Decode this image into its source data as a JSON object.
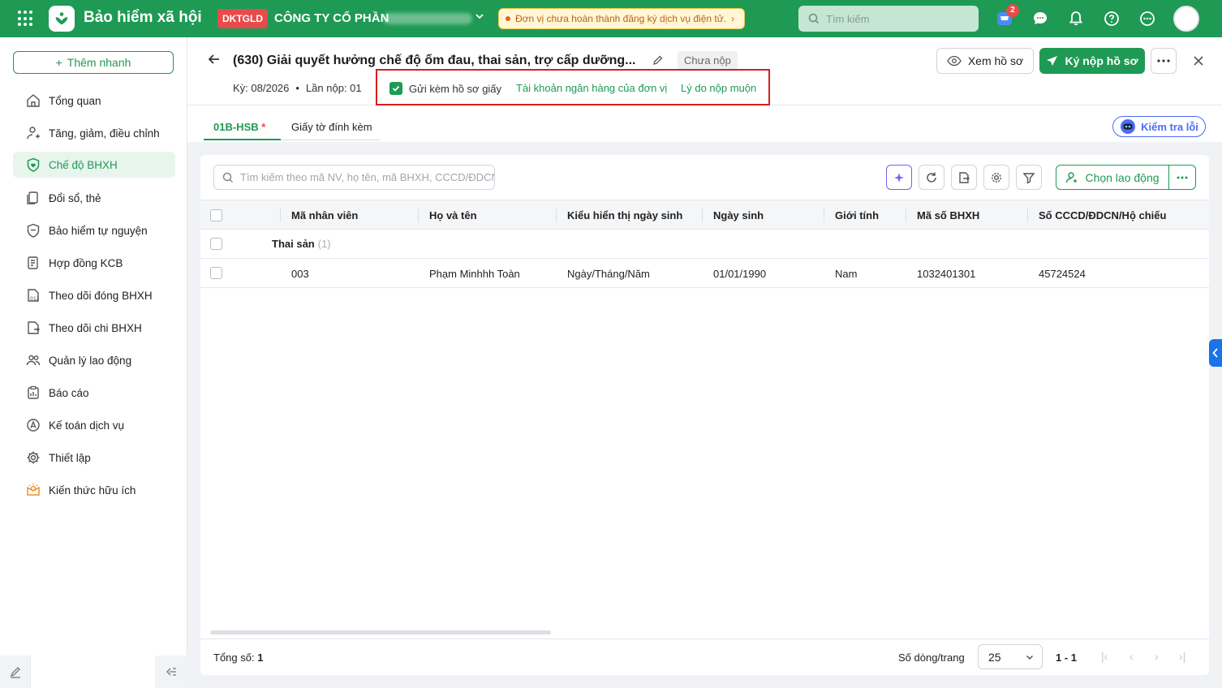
{
  "topbar": {
    "brand": "Bảo hiểm xã hội",
    "badge": "DKTGLD",
    "company": "CÔNG TY CỔ PHẦN",
    "warning": "Đơn vị chưa hoàn thành đăng ký dịch vụ điện tử.",
    "search_placeholder": "Tìm kiếm",
    "cart_count": "2"
  },
  "sidebar": {
    "quick_add": "Thêm nhanh",
    "items": [
      {
        "label": "Tổng quan",
        "icon": "home-icon"
      },
      {
        "label": "Tăng, giảm, điều chỉnh",
        "icon": "user-adjust-icon"
      },
      {
        "label": "Chế độ BHXH",
        "icon": "shield-heart-icon",
        "active": true
      },
      {
        "label": "Đổi sổ, thẻ",
        "icon": "cards-icon"
      },
      {
        "label": "Bảo hiểm tự nguyện",
        "icon": "shield-icon"
      },
      {
        "label": "Hợp đồng KCB",
        "icon": "contract-icon"
      },
      {
        "label": "Theo dõi đóng BHXH",
        "icon": "calendar-icon"
      },
      {
        "label": "Theo dõi chi BHXH",
        "icon": "payout-icon"
      },
      {
        "label": "Quản lý lao động",
        "icon": "people-icon"
      },
      {
        "label": "Báo cáo",
        "icon": "report-icon"
      },
      {
        "label": "Kế toán dịch vụ",
        "icon": "accounting-icon"
      },
      {
        "label": "Thiết lập",
        "icon": "gear-icon"
      },
      {
        "label": "Kiến thức hữu ích",
        "icon": "knowledge-icon"
      }
    ]
  },
  "header": {
    "title": "(630) Giải quyết hưởng chế độ ốm đau, thai sản, trợ cấp dưỡng...",
    "status": "Chưa nộp",
    "period": "Kỳ: 08/2026",
    "submission": "Lần nộp: 01",
    "send_paper": "Gửi kèm hồ sơ giấy",
    "bank_link": "Tài khoản ngân hàng của đơn vị",
    "late_link": "Lý do nộp muộn",
    "view_btn": "Xem hồ sơ",
    "sign_btn": "Ký nộp hồ sơ"
  },
  "tabs": {
    "tab1": "01B-HSB",
    "tab1_required": "*",
    "tab2": "Giấy tờ đính kèm",
    "check_errors": "Kiểm tra lỗi"
  },
  "grid": {
    "search_placeholder": "Tìm kiếm theo mã NV, họ tên, mã BHXH, CCCD/ĐDCN",
    "choose_btn": "Chọn lao động",
    "columns": [
      "Mã nhân viên",
      "Họ và tên",
      "Kiểu hiển thị ngày sinh",
      "Ngày sinh",
      "Giới tính",
      "Mã số BHXH",
      "Số CCCD/ĐDCN/Hộ chiếu"
    ],
    "group": {
      "name": "Thai sản",
      "count": "(1)"
    },
    "rows": [
      {
        "code": "003",
        "name": "Phạm Minhhh Toàn",
        "dob_format": "Ngày/Tháng/Năm",
        "dob": "01/01/1990",
        "gender": "Nam",
        "bhxh": "1032401301",
        "id_no": "45724524"
      }
    ]
  },
  "footer": {
    "total_label": "Tổng số:",
    "total_value": "1",
    "rows_per_page_label": "Số dòng/trang",
    "rows_per_page": "25",
    "range": "1 - 1"
  },
  "colors": {
    "brand": "#1e9a54",
    "highlight": "#d91e1e",
    "ai": "#4a6cf7"
  }
}
